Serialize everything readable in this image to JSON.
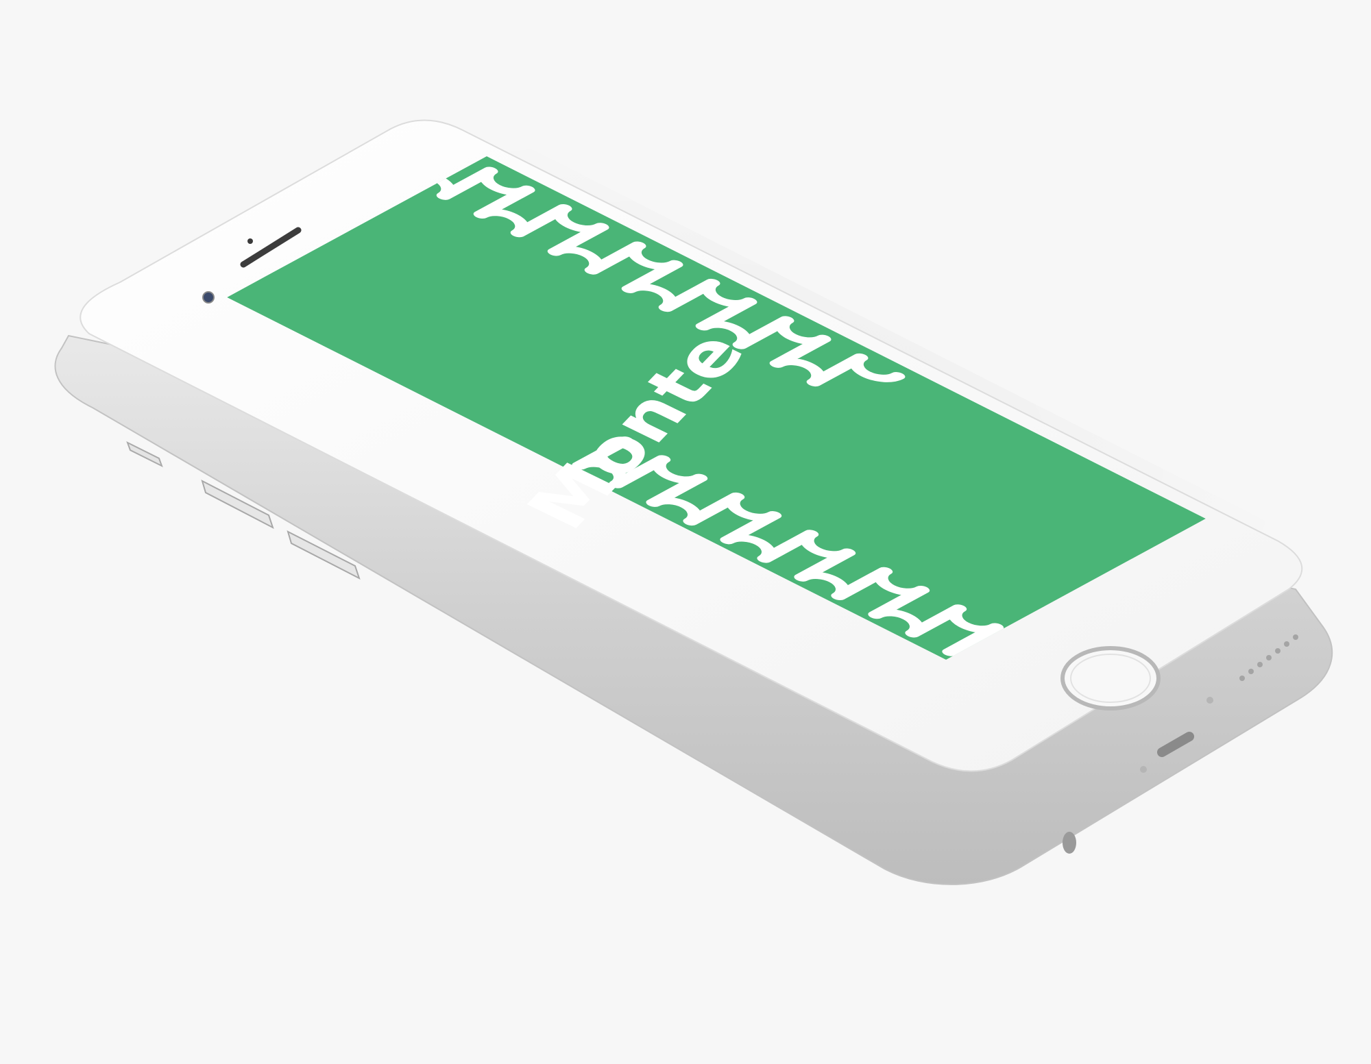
{
  "app": {
    "title": "Monte"
  },
  "colors": {
    "background": "#f7f7f7",
    "screen": "#4ab577",
    "pattern": "#ffffff",
    "title": "#ffffff",
    "device_body": "#fbfbfb",
    "device_edge": "#d4d4d4"
  },
  "icons": {
    "front_camera": "camera-dot-icon",
    "earpiece": "speaker-grille-icon",
    "home_button": "home-button-ring-icon",
    "wave_pattern": "serpentine-wave-pattern"
  }
}
